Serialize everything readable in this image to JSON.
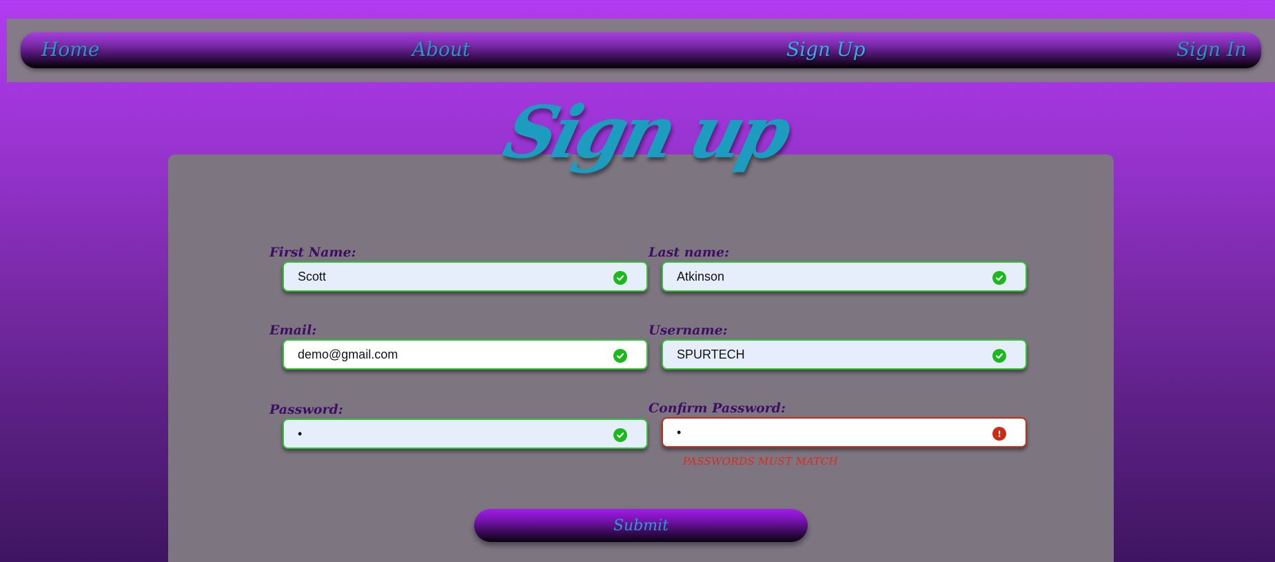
{
  "nav": {
    "items": [
      {
        "label": "Home"
      },
      {
        "label": "About"
      },
      {
        "label": "Sign Up"
      },
      {
        "label": "Sign In"
      }
    ]
  },
  "page": {
    "title": "Sign up"
  },
  "form": {
    "first_name": {
      "label": "First Name:",
      "value": "Scott",
      "status": "valid"
    },
    "last_name": {
      "label": "Last name:",
      "value": "Atkinson",
      "status": "valid"
    },
    "email": {
      "label": "Email:",
      "value": "demo@gmail.com",
      "status": "valid"
    },
    "username": {
      "label": "Username:",
      "value": "SPURTECH",
      "status": "valid"
    },
    "password": {
      "label": "Password:",
      "value": "•",
      "status": "valid"
    },
    "confirm_password": {
      "label": "Confirm Password:",
      "value": "•",
      "status": "invalid",
      "error": "PASSWORDS MUST MATCH"
    },
    "submit_label": "Submit"
  },
  "colors": {
    "valid": "#2fc72f",
    "invalid": "#cc2a14",
    "accent": "#2798c4"
  },
  "icons": {
    "valid": "check-circle-icon",
    "invalid": "exclamation-circle-icon"
  }
}
